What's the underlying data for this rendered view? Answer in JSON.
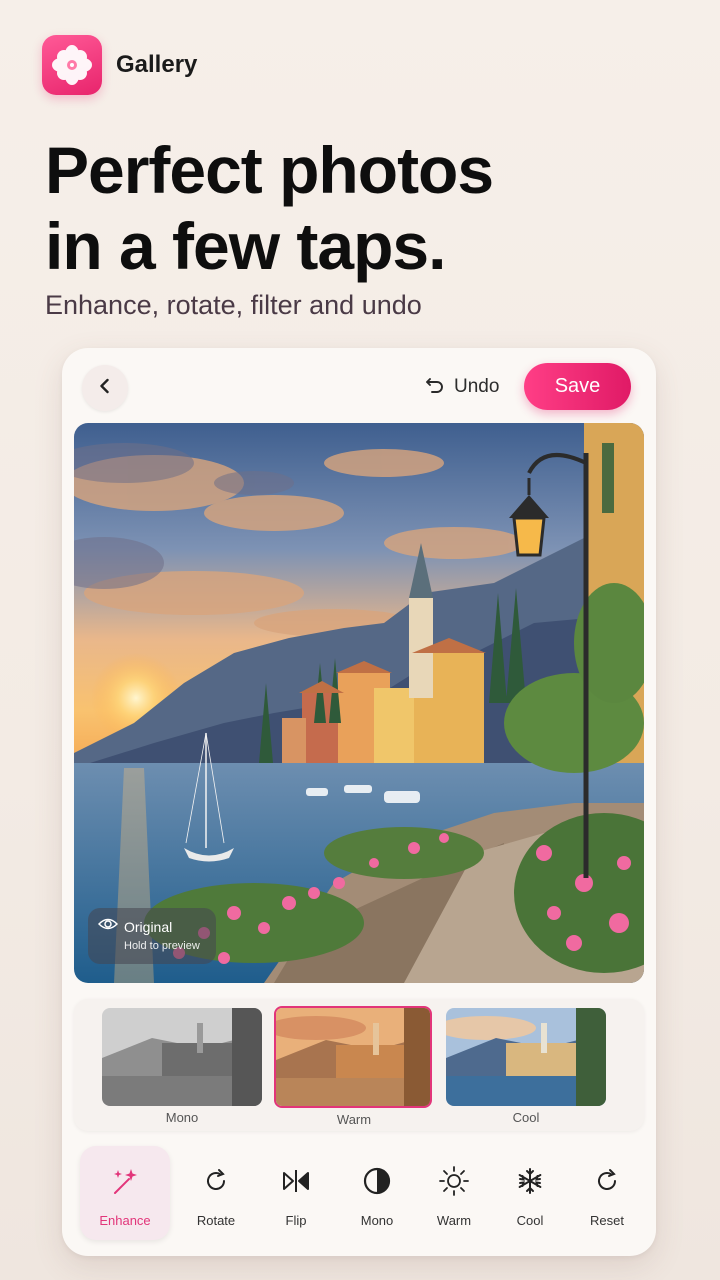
{
  "app": {
    "name": "Gallery",
    "icon": "flower-icon",
    "accent": "#e8246c"
  },
  "hero": {
    "headline_line1": "Perfect photos",
    "headline_line2": "in a few taps.",
    "subhead": "Enhance, rotate, filter and undo"
  },
  "editor": {
    "back_icon": "chevron-left-icon",
    "undo_label": "Undo",
    "undo_icon": "undo-icon",
    "save_label": "Save",
    "preview": {
      "title": "Original",
      "hint": "Hold to preview",
      "icon": "eye-icon"
    },
    "filters": [
      {
        "label": "Mono",
        "selected": false
      },
      {
        "label": "Warm",
        "selected": true
      },
      {
        "label": "Cool",
        "selected": false
      }
    ],
    "tools": [
      {
        "label": "Enhance",
        "icon": "magic-wand-icon",
        "active": true
      },
      {
        "label": "Rotate",
        "icon": "rotate-icon",
        "active": false
      },
      {
        "label": "Flip",
        "icon": "flip-icon",
        "active": false
      },
      {
        "label": "Mono",
        "icon": "contrast-icon",
        "active": false
      },
      {
        "label": "Warm",
        "icon": "sun-icon",
        "active": false
      },
      {
        "label": "Cool",
        "icon": "snowflake-icon",
        "active": false
      },
      {
        "label": "Reset",
        "icon": "reset-icon",
        "active": false
      }
    ]
  }
}
